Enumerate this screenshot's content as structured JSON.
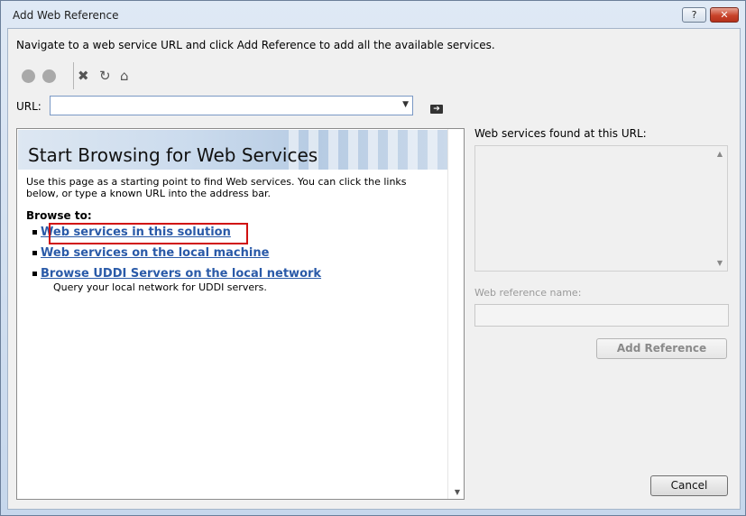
{
  "window": {
    "title": "Add Web Reference",
    "help_label": "?",
    "close_label": "✕"
  },
  "instructions": "Navigate to a web service URL and click Add Reference to add all the available services.",
  "toolbar": {
    "back_icon": "back-circle-icon",
    "forward_icon": "forward-circle-icon",
    "stop_glyph": "✖",
    "refresh_glyph": "↻",
    "home_glyph": "⌂"
  },
  "url": {
    "label": "URL:",
    "value": "",
    "dropdown_glyph": "▼",
    "go_glyph": "➔"
  },
  "browser": {
    "title": "Start Browsing for Web Services",
    "intro": "Use this page as a starting point to find Web services. You can click the links below, or type a known URL into the address bar.",
    "browse_to": "Browse to:",
    "links": [
      {
        "label": "Web services in this solution"
      },
      {
        "label": "Web services on the local machine"
      },
      {
        "label": "Browse UDDI Servers on the local network",
        "description": "Query your local network for UDDI servers."
      }
    ],
    "scroll_down_glyph": "▼"
  },
  "right_panel": {
    "found_label": "Web services found at this URL:",
    "scroll_up_glyph": "▲",
    "scroll_down_glyph": "▼",
    "ref_name_label": "Web reference name:",
    "ref_name_value": "",
    "add_reference_label": "Add Reference"
  },
  "footer": {
    "cancel_label": "Cancel"
  },
  "colors": {
    "link": "#2a5aa8",
    "highlight": "#d01010",
    "close": "#c8432a"
  }
}
